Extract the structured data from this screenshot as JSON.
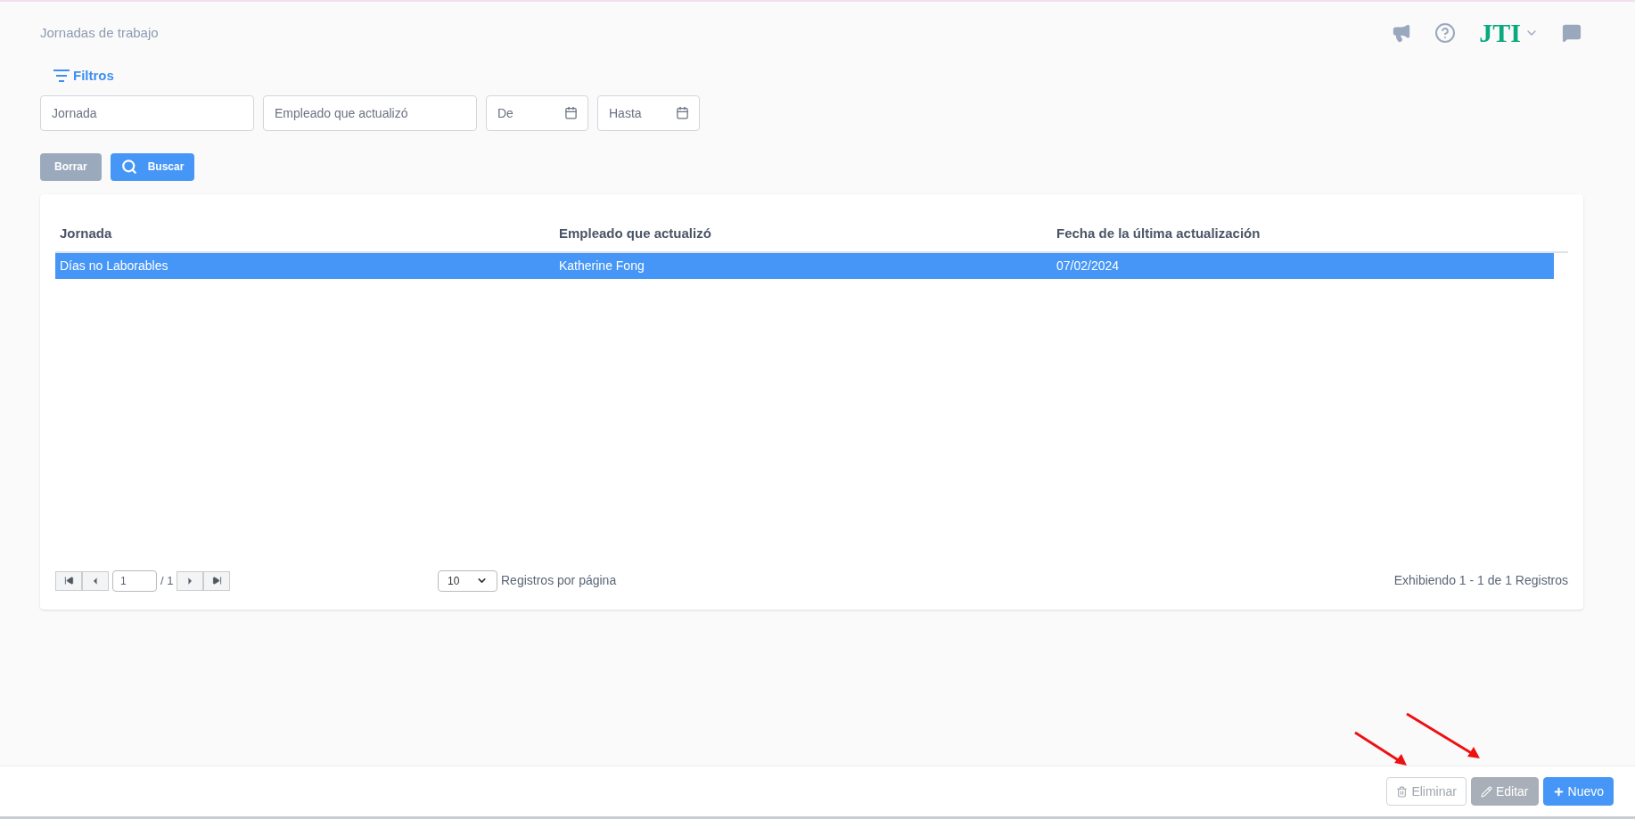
{
  "header": {
    "title": "Jornadas de trabajo",
    "logo": "JTI"
  },
  "filters": {
    "label": "Filtros",
    "fields": [
      {
        "kind": "text",
        "placeholder": "Jornada"
      },
      {
        "kind": "text",
        "placeholder": "Empleado que actualizó"
      },
      {
        "kind": "date",
        "placeholder": "De"
      },
      {
        "kind": "date",
        "placeholder": "Hasta"
      }
    ],
    "buttons": [
      {
        "kind": "secondary",
        "label": "Borrar"
      },
      {
        "kind": "search",
        "label": "Buscar"
      }
    ]
  },
  "table": {
    "columns": [
      "Jornada",
      "Empleado que actualizó",
      "Fecha de la última actualización"
    ],
    "rows": [
      {
        "cells": [
          "Días no Laborables",
          "Katherine Fong",
          "07/02/2024"
        ],
        "selected": true
      }
    ]
  },
  "pagination": {
    "page": "1",
    "total": "/ 1",
    "page_size": "10",
    "page_size_label": "Registros por página",
    "summary": "Exhibiendo 1 - 1 de 1 Registros"
  },
  "actions": [
    {
      "kind": "delete",
      "label": "Eliminar"
    },
    {
      "kind": "edit",
      "label": "Editar"
    },
    {
      "kind": "new",
      "label": "Nuevo"
    }
  ]
}
